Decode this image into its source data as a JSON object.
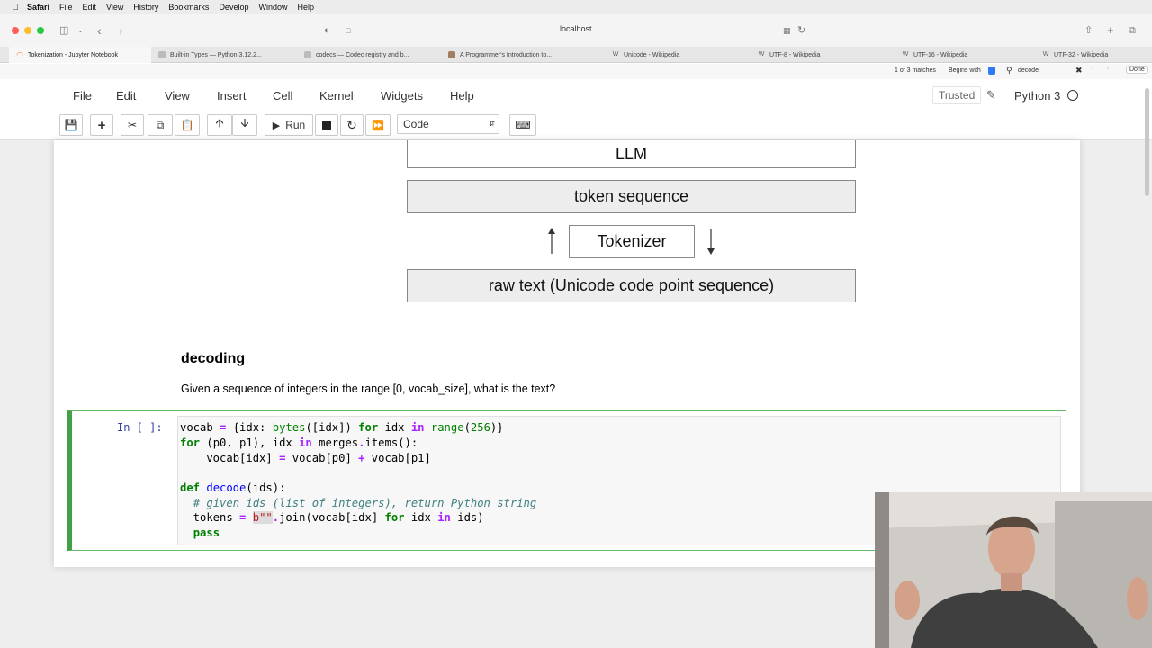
{
  "os_menu": {
    "app": "Safari",
    "items": [
      "File",
      "Edit",
      "View",
      "History",
      "Bookmarks",
      "Develop",
      "Window",
      "Help"
    ]
  },
  "browser": {
    "address": "localhost",
    "tabs": [
      {
        "label": "Tokenization - Jupyter Notebook",
        "active": true
      },
      {
        "label": "Built-in Types — Python 3.12.2...",
        "active": false
      },
      {
        "label": "codecs — Codec registry and b...",
        "active": false
      },
      {
        "label": "A Programmer's Introduction to...",
        "active": false
      },
      {
        "label": "Unicode - Wikipedia",
        "active": false
      },
      {
        "label": "UTF-8 - Wikipedia",
        "active": false
      },
      {
        "label": "UTF-16 - Wikipedia",
        "active": false
      },
      {
        "label": "UTF-32 - Wikipedia",
        "active": false
      }
    ],
    "find": {
      "matches": "1 of 3 matches",
      "mode": "Begins with",
      "query": "decode",
      "done_label": "Done"
    }
  },
  "jupyter": {
    "menu": [
      "File",
      "Edit",
      "View",
      "Insert",
      "Cell",
      "Kernel",
      "Widgets",
      "Help"
    ],
    "trusted": "Trusted",
    "kernel": "Python 3",
    "run_label": "Run",
    "cell_type": "Code"
  },
  "diagram": {
    "llm": "LLM",
    "token_sequence": "token sequence",
    "tokenizer": "Tokenizer",
    "raw_text": "raw text (Unicode code point sequence)"
  },
  "markdown": {
    "heading": "decoding",
    "text": "Given a sequence of integers in the range [0, vocab_size], what is the text?"
  },
  "code_cell": {
    "prompt": "In [ ]:"
  },
  "colors": {
    "cell_border": "#42a047",
    "prompt": "#303f9f",
    "keyword": "#008000"
  }
}
